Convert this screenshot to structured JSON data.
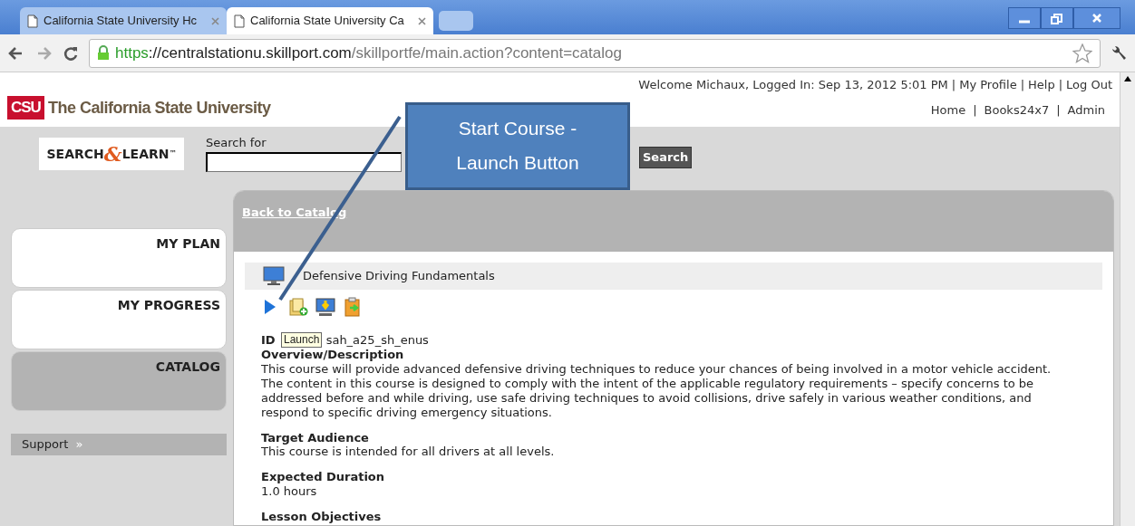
{
  "browser": {
    "tabs": [
      {
        "title": "California State University  Hc",
        "selected": false
      },
      {
        "title": "California State University  Ca",
        "selected": true
      }
    ],
    "url": {
      "scheme": "https",
      "host": "://centralstationu.skillport.com",
      "path": "/skillportfe/main.action?content=catalog"
    }
  },
  "header": {
    "logo_mark": "CSU",
    "logo_text": "The California State University",
    "welcome": "Welcome Michaux, Logged In: Sep 13, 2012 5:01 PM",
    "user_links": [
      "My Profile",
      "Help",
      "Log Out"
    ],
    "nav_links": [
      "Home",
      "Books24x7",
      "Admin"
    ],
    "separator": "|"
  },
  "search": {
    "brand_left": "SEARCH",
    "brand_amp": "&",
    "brand_right": "LEARN",
    "brand_tm": "™",
    "label": "Search for",
    "button": "Search"
  },
  "sidebar": {
    "items": [
      {
        "label": "MY PLAN",
        "selected": false
      },
      {
        "label": "MY PROGRESS",
        "selected": false
      },
      {
        "label": "CATALOG",
        "selected": true
      }
    ],
    "support": "Support",
    "support_arrow": "»"
  },
  "course": {
    "back_link": "Back to Catalog",
    "title": "Defensive Driving Fundamentals",
    "id_label": "ID",
    "id_value": "sah_a25_sh_enus",
    "tooltip": "Launch",
    "sections": [
      {
        "heading": "Overview/Description",
        "body": "This course will provide advanced defensive driving techniques to reduce your chances of being involved in a motor vehicle accident. The content in this course is designed to comply with the intent of the applicable regulatory requirements – specify concerns to be addressed before and while driving, use safe driving techniques to avoid collisions, drive safely in various weather conditions, and respond to specific driving emergency situations."
      },
      {
        "heading": "Target Audience",
        "body": "This course is intended for all drivers at all levels."
      },
      {
        "heading": "Expected Duration",
        "body": "1.0 hours"
      },
      {
        "heading": "Lesson Objectives"
      }
    ]
  },
  "callout": {
    "lines": [
      "Start Course -",
      "Launch Button"
    ]
  }
}
